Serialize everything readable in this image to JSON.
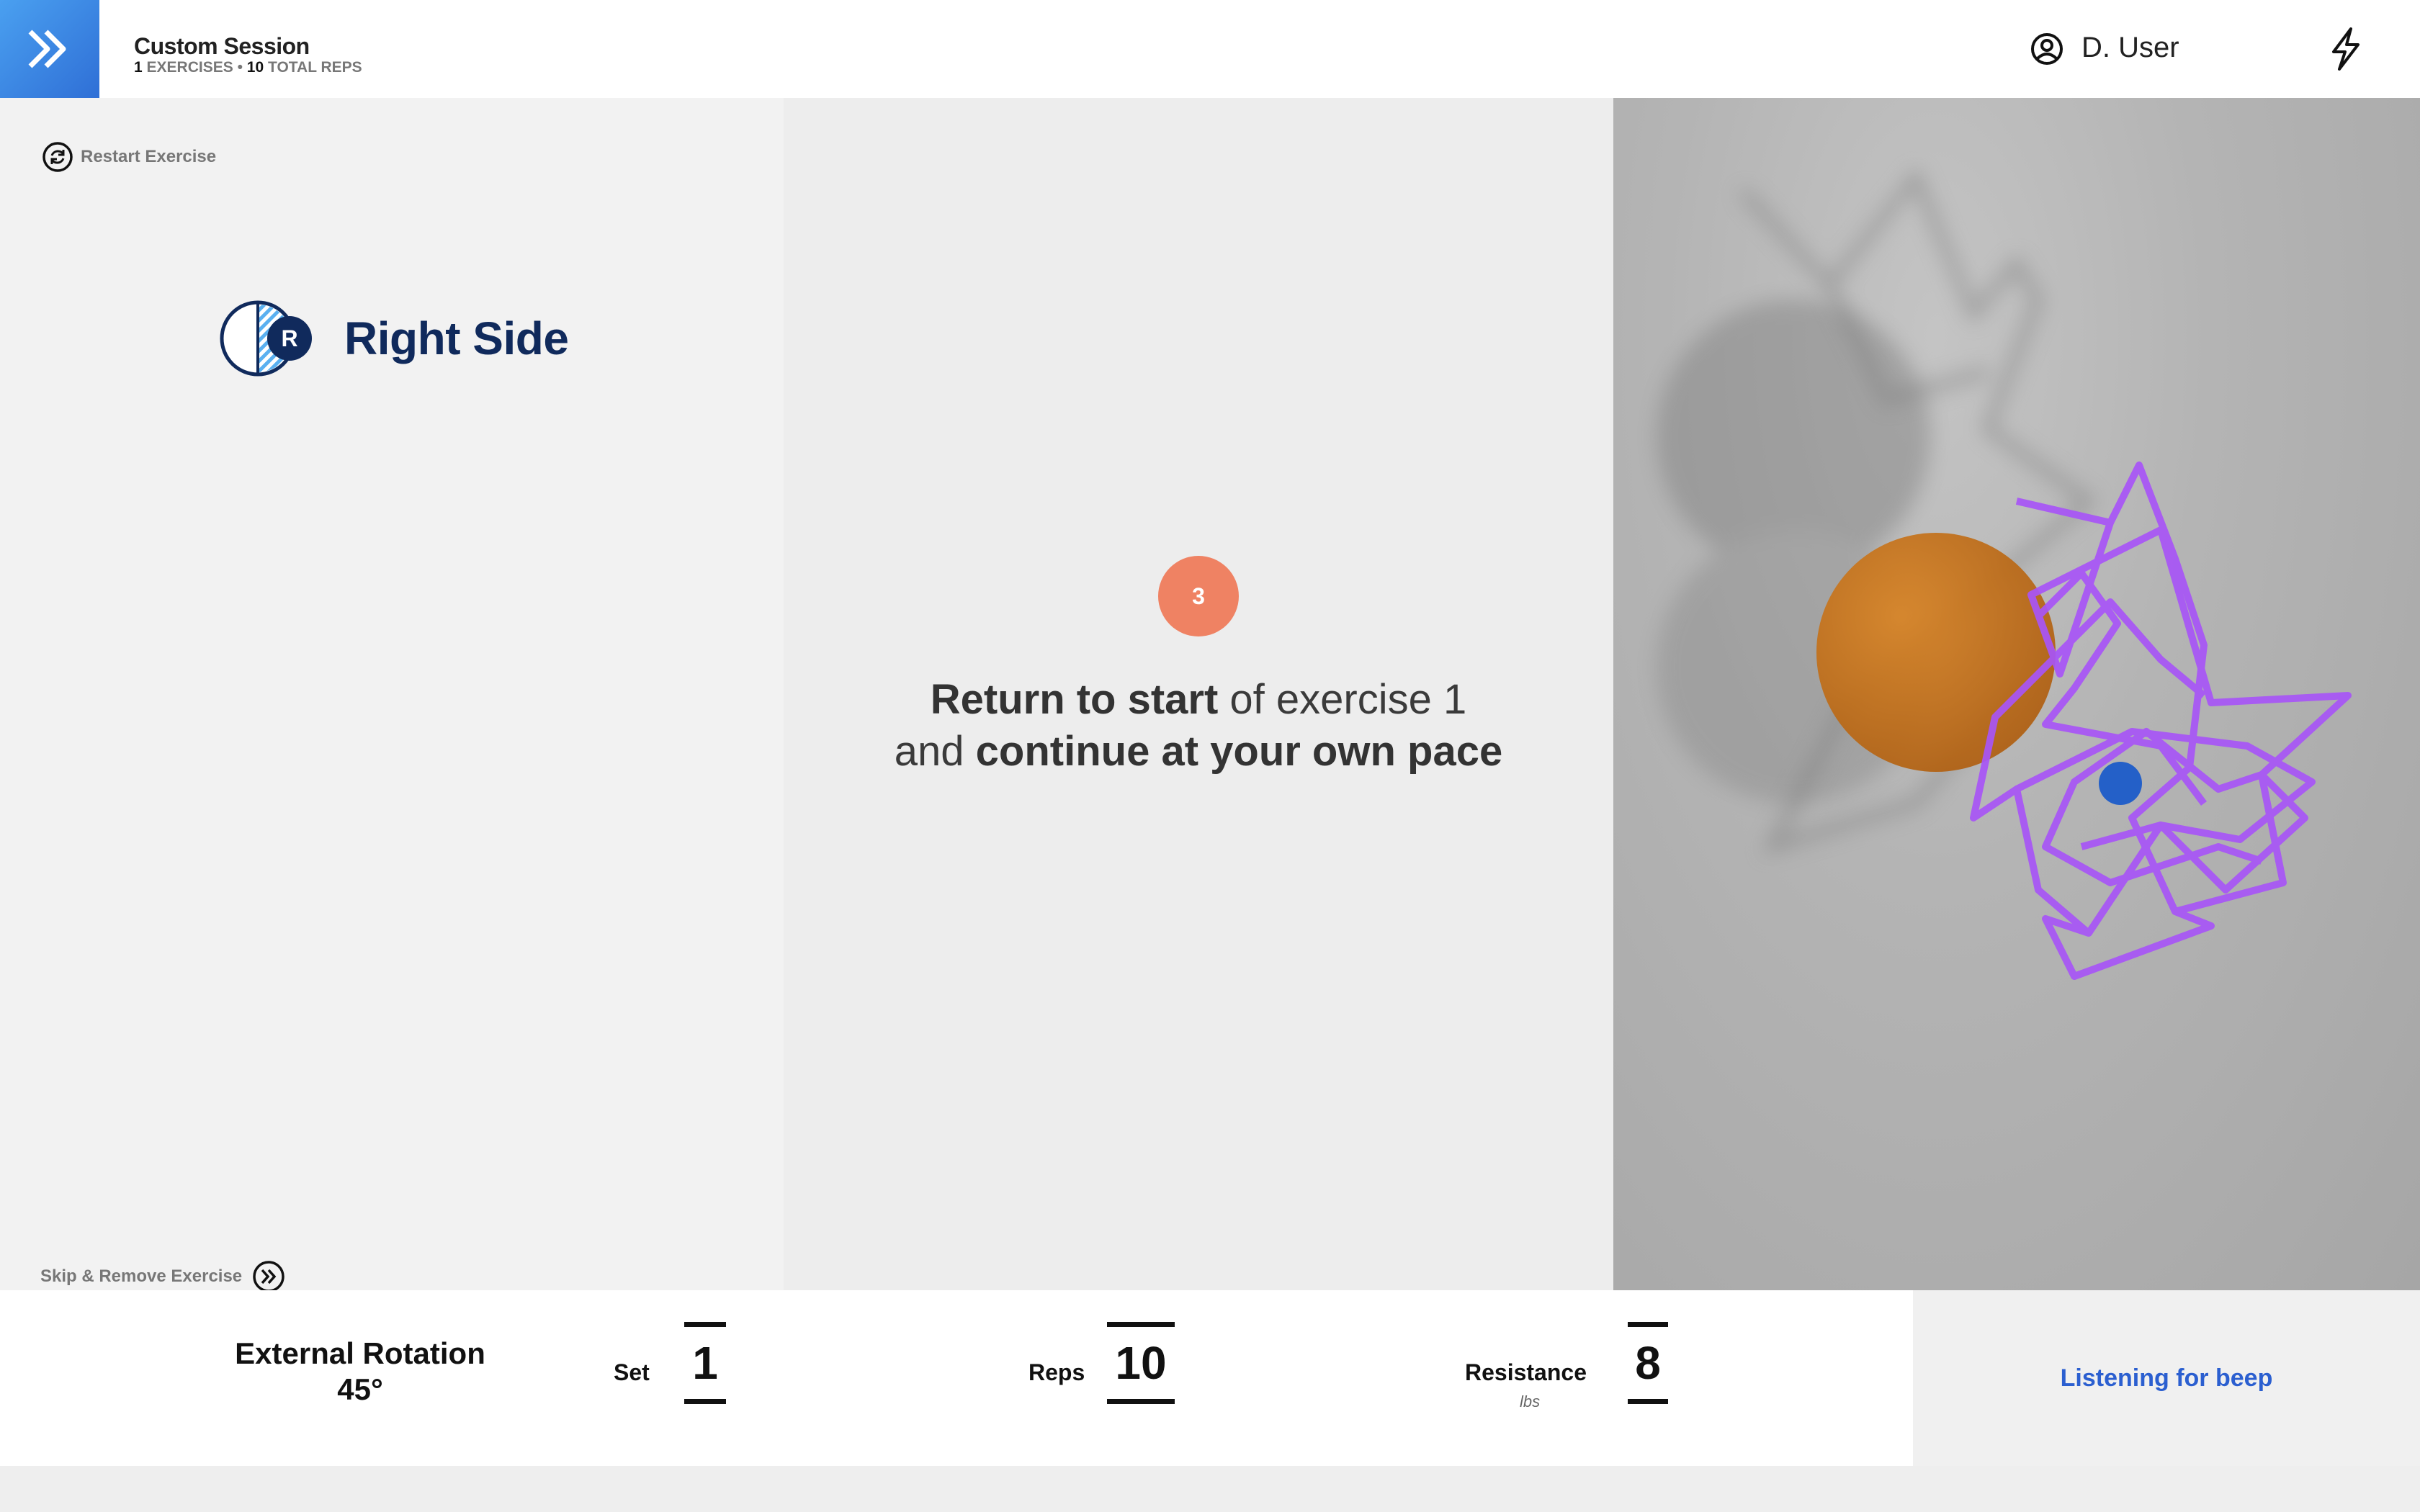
{
  "header": {
    "session_title": "Custom Session",
    "exercise_count": "1",
    "exercise_count_label": "EXERCISES",
    "separator": "•",
    "total_reps": "10",
    "total_reps_label": "TOTAL REPS",
    "user_name": "D. User",
    "logo_icon": "double-chevron-right-icon",
    "user_icon": "user-circle-icon",
    "power_icon": "lightning-icon"
  },
  "left": {
    "restart_label": "Restart Exercise",
    "restart_icon": "refresh-icon",
    "side_badge": "R",
    "side_label": "Right Side",
    "skip_label": "Skip & Remove Exercise",
    "skip_icon": "double-chevron-circle-icon"
  },
  "center": {
    "countdown": "3",
    "instruction_line1_bold": "Return to start",
    "instruction_line1_rest": " of exercise 1",
    "instruction_line2_prefix": "and ",
    "instruction_line2_bold": "continue at your own pace"
  },
  "bottom": {
    "exercise_name": "External Rotation",
    "exercise_angle": "45°",
    "set_label": "Set",
    "set_value": "1",
    "reps_label": "Reps",
    "reps_value": "10",
    "resistance_label": "Resistance",
    "resistance_value": "8",
    "resistance_unit": "lbs",
    "status": "Listening for beep"
  },
  "colors": {
    "brand_blue": "#2f6fd6",
    "navy": "#102a5c",
    "countdown": "#ef8263",
    "status_blue": "#2b5fd0",
    "wireframe": "#a855f7",
    "orb": "#c8741a"
  }
}
